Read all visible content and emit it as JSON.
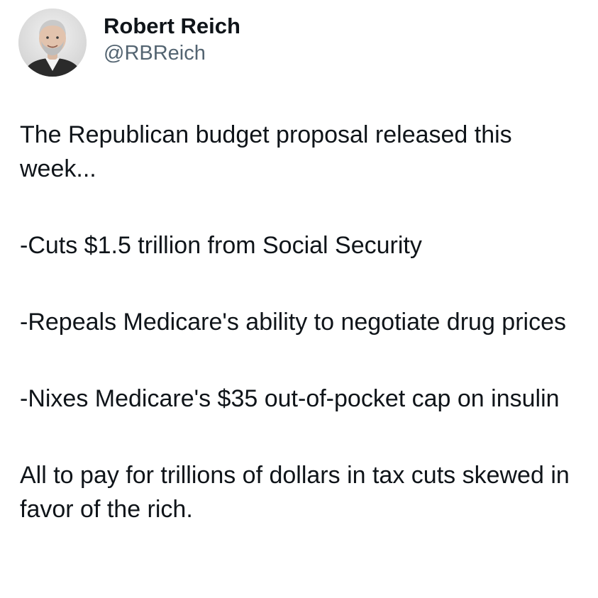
{
  "author": {
    "display_name": "Robert Reich",
    "handle": "@RBReich"
  },
  "post": {
    "paragraphs": [
      "The Republican budget proposal released this week...",
      "-Cuts $1.5 trillion from Social Security",
      "-Repeals Medicare's ability to negotiate drug prices",
      "-Nixes Medicare's $35 out-of-pocket cap on insulin",
      "All to pay for trillions of dollars in tax cuts skewed in favor of the rich."
    ]
  },
  "icons": {
    "avatar": "profile-photo"
  }
}
